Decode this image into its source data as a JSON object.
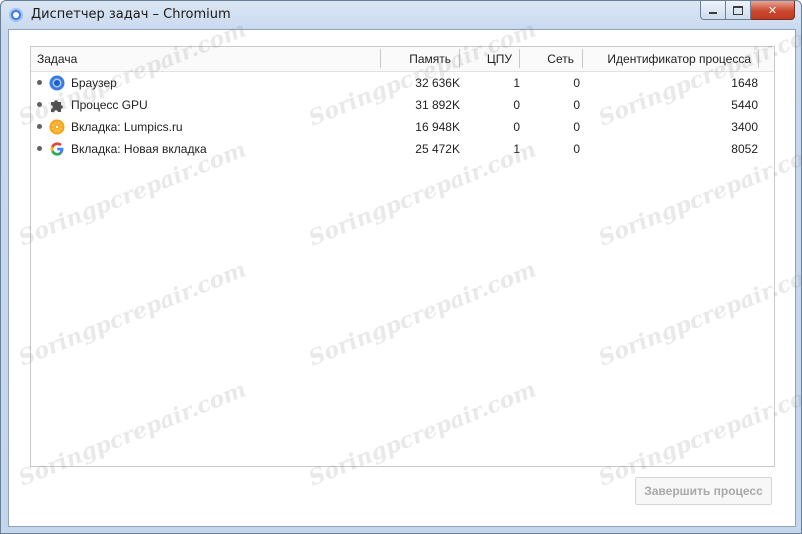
{
  "window": {
    "title": "Диспетчер задач – Chromium",
    "controls": {
      "minimize": "minimize",
      "maximize": "maximize",
      "close": "close"
    }
  },
  "table": {
    "columns": {
      "task": "Задача",
      "memory": "Память",
      "cpu": "ЦПУ",
      "network": "Сеть",
      "pid": "Идентификатор процесса"
    },
    "rows": [
      {
        "task": "Браузер",
        "icon": "chromium-icon",
        "memory": "32 636K",
        "cpu": "1",
        "network": "0",
        "pid": "1648"
      },
      {
        "task": "Процесс GPU",
        "icon": "puzzle-icon",
        "memory": "31 892K",
        "cpu": "0",
        "network": "0",
        "pid": "5440"
      },
      {
        "task": "Вкладка: Lumpics.ru",
        "icon": "orange-icon",
        "memory": "16 948K",
        "cpu": "0",
        "network": "0",
        "pid": "3400"
      },
      {
        "task": "Вкладка: Новая вкладка",
        "icon": "google-icon",
        "memory": "25 472K",
        "cpu": "1",
        "network": "0",
        "pid": "8052"
      }
    ]
  },
  "end_process_button": "Завершить процесс",
  "watermark": "Soringpcrepair.com"
}
